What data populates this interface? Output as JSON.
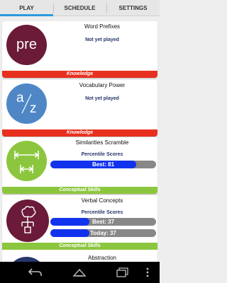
{
  "tabs": [
    {
      "label": "PLAY",
      "active": true
    },
    {
      "label": "SCHEDULE",
      "active": false
    },
    {
      "label": "SETTINGS",
      "active": false
    }
  ],
  "colors": {
    "tab_indicator": "#2a9be0",
    "knowledge": "#e8301e",
    "conceptual_skills": "#8cc63e",
    "score_bar": "#1133ee",
    "score_track": "#888888",
    "word_prefixes_circle": "#6b1a37",
    "vocabulary_circle": "#4f87c6",
    "similarities_circle": "#8cc63e",
    "verbal_concepts_circle": "#6b1a3a",
    "abstraction_circle": "#27356b"
  },
  "cards": [
    {
      "title": "Word Prefixes",
      "icon": "pre-text-icon",
      "icon_text": "pre",
      "status": "Not yet played",
      "category": "Knowledge"
    },
    {
      "title": "Vocabulary Power",
      "icon": "a-slash-z-icon",
      "icon_text_a": "a",
      "icon_text_z": "z",
      "status": "Not yet played",
      "category": "Knowledge"
    },
    {
      "title": "Similarities Scramble",
      "icon": "measure-arrows-icon",
      "score_heading": "Percentile Scores",
      "best_label": "Best: 81",
      "best_value": 81,
      "category": "Conceptual Skills"
    },
    {
      "title": "Verbal Concepts",
      "icon": "concept-tree-icon",
      "score_heading": "Percentile Scores",
      "best_label": "Best: 37",
      "best_value": 37,
      "today_label": "Today: 37",
      "today_value": 37,
      "category": "Conceptual Skills"
    },
    {
      "title": "Abstraction",
      "icon": "abstraction-icon"
    }
  ],
  "navbar": {
    "back": "back-icon",
    "home": "home-icon",
    "recents": "recents-icon",
    "menu": "overflow-menu-icon"
  }
}
